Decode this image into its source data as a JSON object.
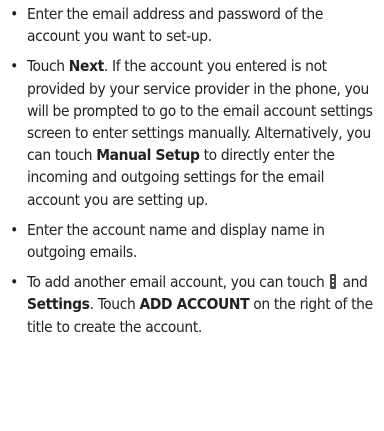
{
  "bullet_char": "•",
  "items": [
    {
      "text": "Enter the email address and password of the account you want to set-up."
    },
    {
      "t1": "Touch ",
      "b1": "Next",
      "t2": ". If the account you entered is not provided by your service provider in the phone, you will be prompted to go to the email account settings screen to enter settings manually. Alternatively, you can touch ",
      "b2": "Manual Setup",
      "t3": " to directly enter the incoming and outgoing settings for the email account you are setting up."
    },
    {
      "text": "Enter the account name and display name in outgoing emails."
    },
    {
      "t1": "To add another email account, you can touch ",
      "icon": "menu-icon",
      "t2": " and ",
      "b1": "Settings",
      "t3": ". Touch ",
      "b2": "ADD ACCOUNT",
      "t4": " on the right of the title to create the account."
    }
  ]
}
